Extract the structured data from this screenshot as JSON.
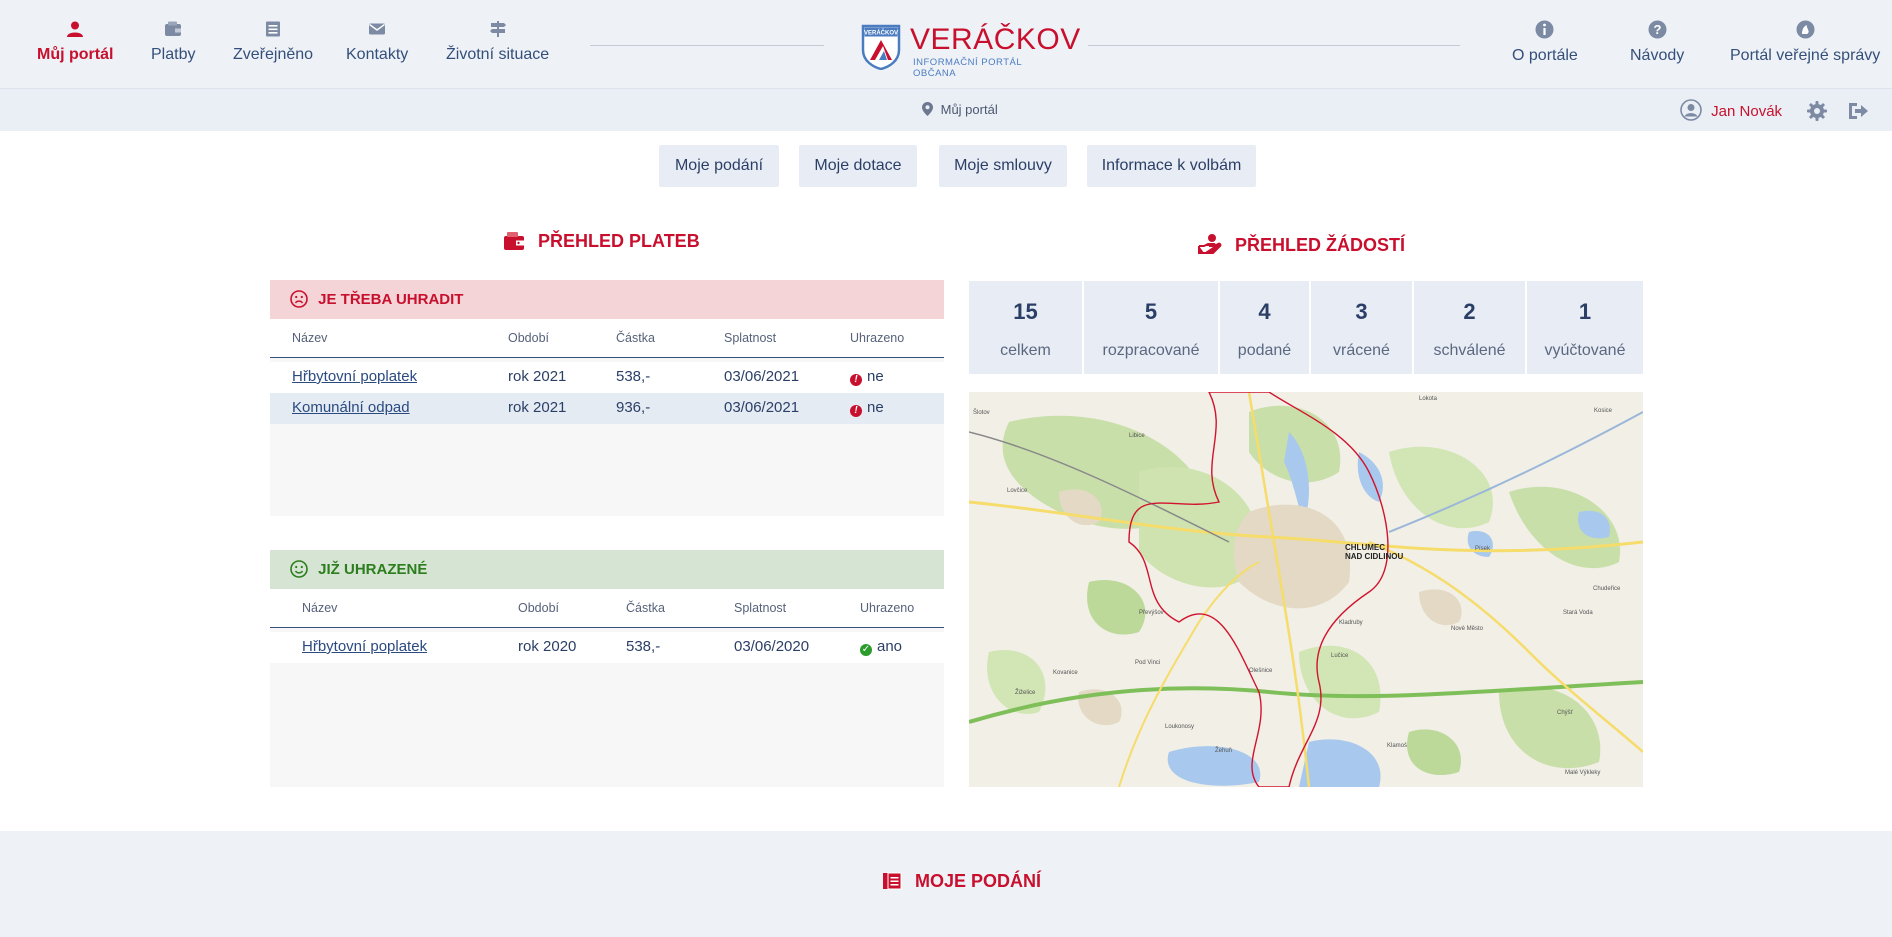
{
  "nav": {
    "items": [
      {
        "label": "Můj portál",
        "icon": "user-icon"
      },
      {
        "label": "Platby",
        "icon": "wallet-icon"
      },
      {
        "label": "Zveřejněno",
        "icon": "document-list-icon"
      },
      {
        "label": "Kontakty",
        "icon": "envelope-icon"
      },
      {
        "label": "Životní situace",
        "icon": "signpost-icon"
      }
    ],
    "right_items": [
      {
        "label": "O portále",
        "icon": "info-icon"
      },
      {
        "label": "Návody",
        "icon": "question-icon"
      },
      {
        "label": "Portál veřejné správy",
        "icon": "lion-emblem-icon"
      }
    ]
  },
  "logo": {
    "name": "VERÁČKOV",
    "subtitle": "INFORMAČNÍ PORTÁL OBČANA",
    "crest_text": "VERÁČKOV"
  },
  "breadcrumb": {
    "label": "Můj portál"
  },
  "user": {
    "name": "Jan Novák"
  },
  "colors": {
    "accent": "#c8102e",
    "primary_text": "#2b3f66",
    "paid_green": "#2c7d1d",
    "due_bg": "#f4d4d6",
    "paid_bg": "#d6e5d3"
  },
  "tabs": [
    "Moje podání",
    "Moje dotace",
    "Moje smlouvy",
    "Informace k volbám"
  ],
  "payments": {
    "heading": "PŘEHLED PLATEB",
    "due": {
      "title": "JE TŘEBA UHRADIT",
      "columns": [
        "Název",
        "Období",
        "Částka",
        "Splatnost",
        "Uhrazeno"
      ],
      "rows": [
        {
          "name": "Hřbytovní poplatek",
          "period": "rok 2021",
          "amount": "538,-",
          "due": "03/06/2021",
          "paid": "ne"
        },
        {
          "name": "Komunální odpad",
          "period": "rok 2021",
          "amount": "936,-",
          "due": "03/06/2021",
          "paid": "ne"
        }
      ]
    },
    "paid": {
      "title": "JIŽ UHRAZENÉ",
      "columns": [
        "Název",
        "Období",
        "Částka",
        "Splatnost",
        "Uhrazeno"
      ],
      "rows": [
        {
          "name": "Hřbytovní poplatek",
          "period": "rok 2020",
          "amount": "538,-",
          "due": "03/06/2020",
          "paid": "ano"
        }
      ]
    }
  },
  "requests": {
    "heading": "PŘEHLED ŽÁDOSTÍ",
    "stats": [
      {
        "value": "15",
        "label": "celkem"
      },
      {
        "value": "5",
        "label": "rozpracované"
      },
      {
        "value": "4",
        "label": "podané"
      },
      {
        "value": "3",
        "label": "vrácené"
      },
      {
        "value": "2",
        "label": "schválené"
      },
      {
        "value": "1",
        "label": "vyúčtované"
      }
    ]
  },
  "map": {
    "town_label_1": "CHLUMEC",
    "town_label_2": "NAD CIDLINOU",
    "places": [
      "Lokota",
      "Libice",
      "Kosice",
      "Lovčice",
      "Písek",
      "Chudeřice",
      "Stará Voda",
      "Nové Město",
      "Převýšov",
      "Kladruby",
      "Lučice",
      "Žiželice",
      "Olešnice",
      "Klamoš",
      "Chýšť",
      "Malé Výkleky",
      "Pod Vinci",
      "Kovanice",
      "Loukonosy",
      "Žehuň",
      "Šlotov"
    ]
  },
  "bottom": {
    "heading": "MOJE PODÁNÍ"
  }
}
